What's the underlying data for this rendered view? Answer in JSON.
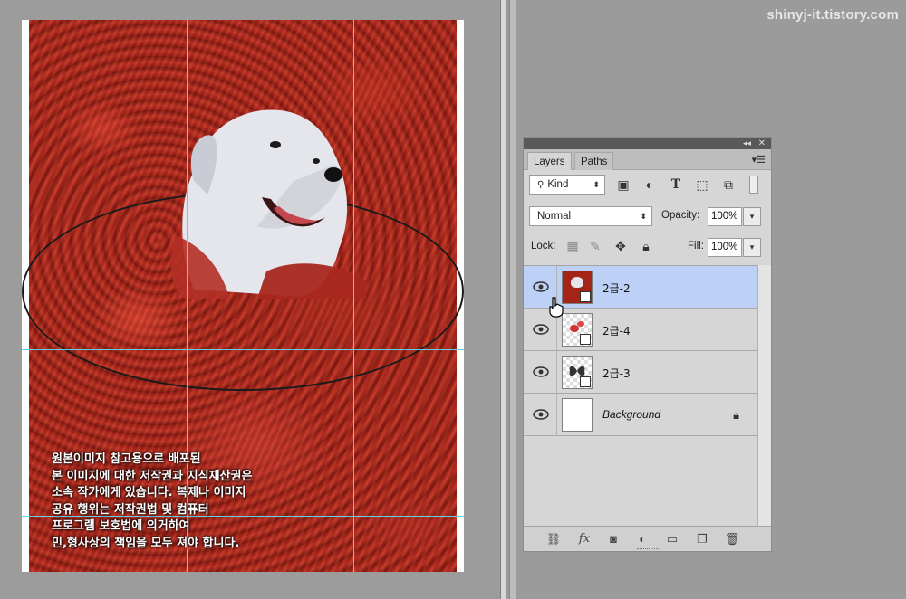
{
  "watermark": "shinyj-it.tistory.com",
  "canvas": {
    "notice_lines": [
      "원본이미지 참고용으로 배포된",
      "본 이미지에 대한 저작권과 지식재산권은",
      "소속 작가에게 있습니다. 복제나 이미지",
      "공유 행위는 저작권법 및 컴퓨터",
      "프로그램 보호법에 의거하여",
      "민,형사상의 책임을 모두 져야 합니다."
    ]
  },
  "layers_panel": {
    "tabs": [
      "Layers",
      "Paths"
    ],
    "active_tab": "Layers",
    "filter_kind": "Kind",
    "blend_mode": "Normal",
    "opacity_label": "Opacity:",
    "opacity_value": "100%",
    "lock_label": "Lock:",
    "fill_label": "Fill:",
    "fill_value": "100%",
    "layers": [
      {
        "name": "2급-2",
        "selected": true,
        "visible": true,
        "type": "smart-object-photo"
      },
      {
        "name": "2급-4",
        "selected": false,
        "visible": true,
        "type": "smart-object-flowers"
      },
      {
        "name": "2급-3",
        "selected": false,
        "visible": true,
        "type": "smart-object-butterfly"
      },
      {
        "name": "Background",
        "selected": false,
        "visible": true,
        "type": "background",
        "locked": true
      }
    ]
  },
  "colors": {
    "selection": "#bdd0f5",
    "guide": "#5fd3e6",
    "workspace": "#9c9c9c"
  }
}
